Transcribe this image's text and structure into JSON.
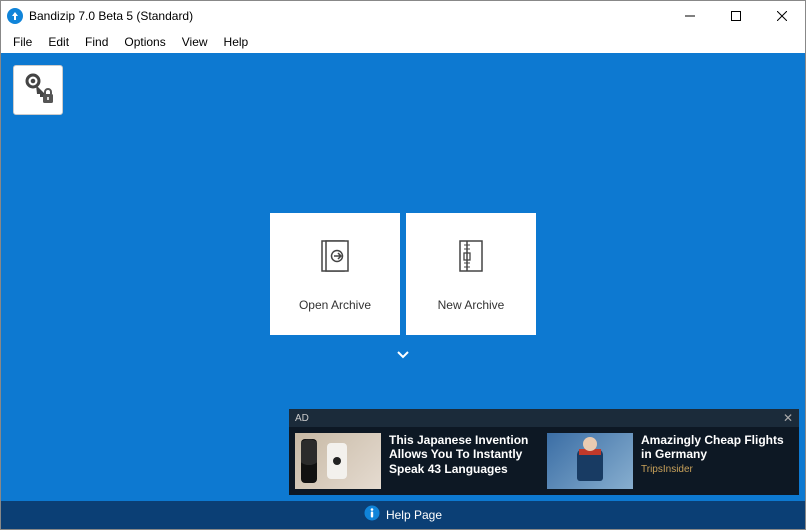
{
  "window": {
    "title": "Bandizip 7.0 Beta 5 (Standard)"
  },
  "menu": {
    "file": "File",
    "edit": "Edit",
    "find": "Find",
    "options": "Options",
    "view": "View",
    "help": "Help"
  },
  "tiles": {
    "open": "Open Archive",
    "new": "New Archive"
  },
  "ad": {
    "label": "AD",
    "items": [
      {
        "title": "This Japanese Invention Allows You To Instantly Speak 43 Languages",
        "sub": ""
      },
      {
        "title": "Amazingly Cheap Flights in Germany",
        "sub": "TripsInsider"
      }
    ]
  },
  "footer": {
    "help": "Help Page"
  }
}
